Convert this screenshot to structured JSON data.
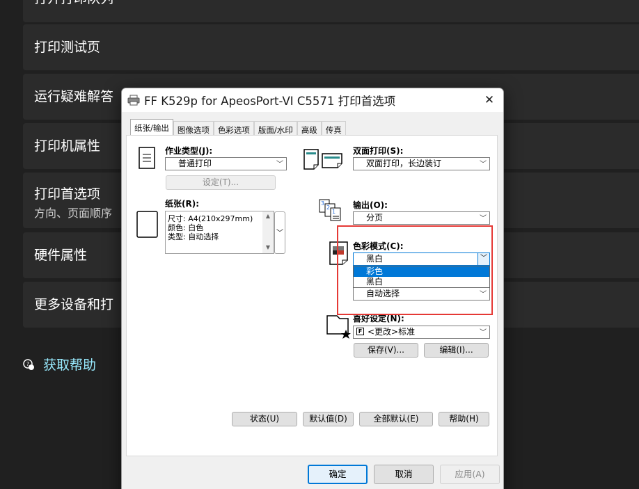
{
  "settings_list": {
    "items": [
      {
        "label": "打开打印队列"
      },
      {
        "label": "打印测试页"
      },
      {
        "label": "运行疑难解答"
      },
      {
        "label": "打印机属性"
      },
      {
        "label": "打印首选项",
        "sub": "方向、页面顺序"
      },
      {
        "label": "硬件属性"
      },
      {
        "label": "更多设备和打"
      }
    ],
    "help_link": "获取帮助"
  },
  "dialog": {
    "title": "FF K529p for ApeosPort-VI C5571 打印首选项",
    "close": "✕",
    "tabs": [
      "纸张/输出",
      "图像选项",
      "色彩选项",
      "版面/水印",
      "高级",
      "传真"
    ],
    "job_type": {
      "label": "作业类型(J):",
      "value": "普通打印",
      "settings_button": "设定(T)..."
    },
    "paper": {
      "label": "纸张(R):",
      "lines": [
        "尺寸: A4(210x297mm)",
        "颜色: 白色",
        "类型: 自动选择"
      ]
    },
    "duplex": {
      "label": "双面打印(S):",
      "value": "双面打印，长边装订"
    },
    "output": {
      "label": "输出(O):",
      "value": "分页"
    },
    "color_mode": {
      "label": "色彩模式(C):",
      "value": "黑白",
      "options": [
        "彩色",
        "黑白"
      ],
      "selected_option": "彩色"
    },
    "hidden_combo": {
      "value": "自动选择"
    },
    "favorites": {
      "label": "喜好设定(N):",
      "value": "<更改>标准",
      "save_button": "保存(V)...",
      "edit_button": "编辑(I)..."
    },
    "bottom_buttons": {
      "status": "状态(U)",
      "defaults": "默认值(D)",
      "all_defaults": "全部默认(E)",
      "help": "帮助(H)"
    },
    "footer": {
      "ok": "确定",
      "cancel": "取消",
      "apply": "应用(A)"
    }
  }
}
